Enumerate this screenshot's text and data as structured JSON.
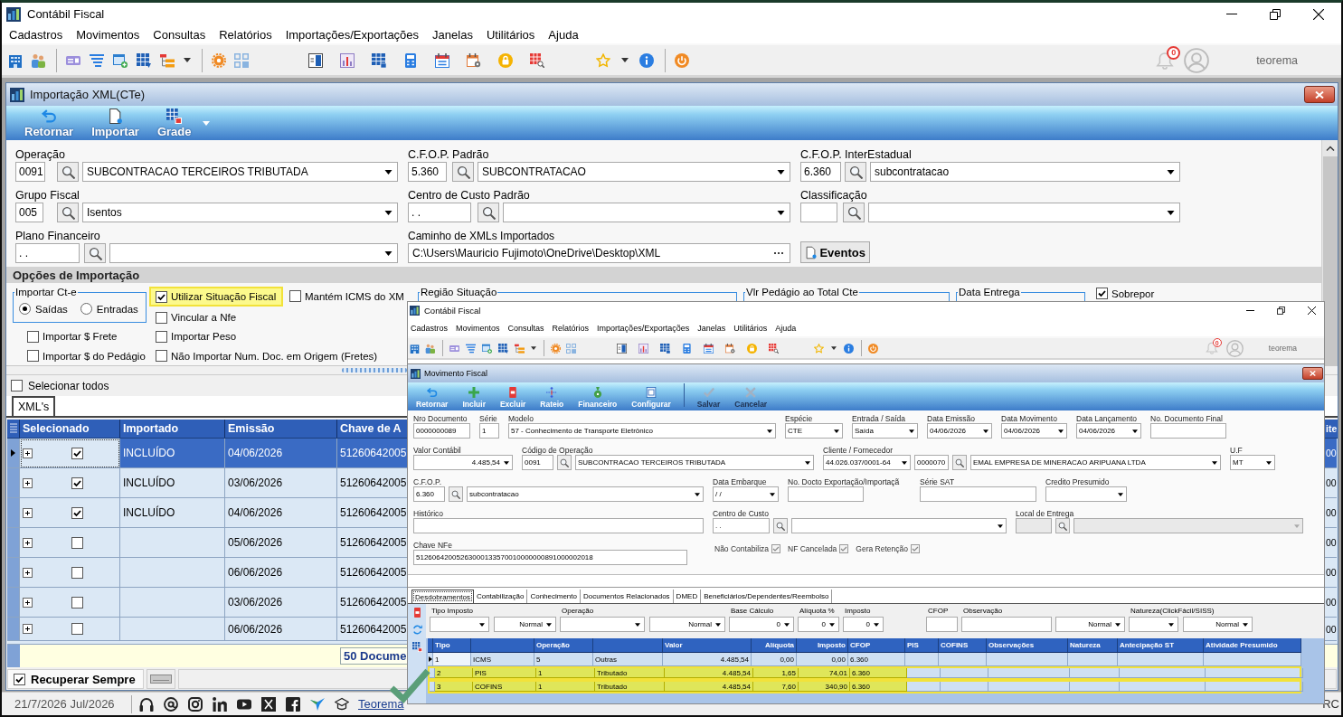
{
  "app": {
    "title": "Contábil Fiscal",
    "menu": [
      "Cadastros",
      "Movimentos",
      "Consultas",
      "Relatórios",
      "Importações/Exportações",
      "Janelas",
      "Utilitários",
      "Ajuda"
    ],
    "notification_count": "0",
    "user": "teorema"
  },
  "window": {
    "title": "Importação XML(CTe)",
    "toolbar": [
      {
        "label": "Retornar",
        "dropdown": false
      },
      {
        "label": "Importar",
        "dropdown": false
      },
      {
        "label": "Grade",
        "dropdown": true
      }
    ]
  },
  "form": {
    "fields": [
      {
        "label": "Operação",
        "code": "0091",
        "description": "SUBCONTRACAO TERCEIROS TRIBUTADA"
      },
      {
        "label": "C.F.O.P. Padrão",
        "code": "5.360",
        "description": "SUBCONTRATACAO"
      },
      {
        "label": "C.F.O.P. InterEstadual",
        "code": "6.360",
        "description": "subcontratacao"
      },
      {
        "label": "Grupo Fiscal",
        "code": "005",
        "description": "Isentos"
      },
      {
        "label": "Centro de Custo Padrão",
        "code": ". ."
      },
      {
        "label": "Classificação"
      },
      {
        "label": "Plano Financeiro",
        "code": ". ."
      }
    ],
    "path": {
      "label": "Caminho de XMLs Importados",
      "value": "C:\\Users\\Mauricio Fujimoto\\OneDrive\\Desktop\\XML"
    },
    "events_button": "Eventos"
  },
  "options": {
    "title": "Opções de Importação",
    "cte_group": {
      "title": "Importar Ct-e",
      "radios": [
        {
          "label": "Saídas",
          "selected": true
        },
        {
          "label": "Entradas",
          "selected": false
        }
      ]
    },
    "checks": [
      {
        "label": "Utilizar Situação Fiscal",
        "checked": true,
        "highlighted": true
      },
      {
        "label": "Vincular a Nfe",
        "checked": false,
        "highlighted": false
      },
      {
        "label": "Mantém ICMS do XM",
        "checked": false,
        "highlighted": false
      },
      {
        "label": "Importar $ Frete",
        "checked": false,
        "highlighted": false
      },
      {
        "label": "Importar $ do Pedágio",
        "checked": false,
        "highlighted": false
      },
      {
        "label": "Importar Peso",
        "checked": false,
        "highlighted": false
      },
      {
        "label": "Não Importar Num. Doc. em Origem (Fretes)",
        "checked": false,
        "highlighted": false
      }
    ],
    "groups": [
      "Região Situação",
      "Vlr Pedágio ao Total Cte",
      "Data Entrega"
    ],
    "overwrite": {
      "label": "Sobrepor",
      "checked": true
    }
  },
  "select_all": {
    "label": "Selecionar todos",
    "checked": false
  },
  "tabs": [
    {
      "label": "XML's",
      "selected": true
    }
  ],
  "table": {
    "columns": [
      "Selecionado",
      "Importado",
      "Emissão",
      "Chave de A",
      "ite"
    ],
    "rows": [
      {
        "current": true,
        "selected": true,
        "checked": true,
        "imported": "INCLUÍDO",
        "issued": "04/06/2026",
        "key": "51260642005",
        "column_5": "00"
      },
      {
        "current": false,
        "selected": false,
        "checked": true,
        "imported": "INCLUÍDO",
        "issued": "03/06/2026",
        "key": "51260642005",
        "column_5": "00"
      },
      {
        "current": false,
        "selected": false,
        "checked": true,
        "imported": "INCLUÍDO",
        "issued": "04/06/2026",
        "key": "51260642005",
        "column_5": "00"
      },
      {
        "current": false,
        "selected": false,
        "checked": false,
        "issued": "05/06/2026",
        "key": "51260642005",
        "column_5": "00"
      },
      {
        "current": false,
        "selected": false,
        "checked": false,
        "issued": "06/06/2026",
        "key": "51260642005",
        "column_5": "00"
      },
      {
        "current": false,
        "selected": false,
        "checked": false,
        "issued": "03/06/2026",
        "key": "51260642005",
        "column_5": "00"
      },
      {
        "current": false,
        "selected": false,
        "checked": false,
        "issued": "06/06/2026",
        "key": "51260642005",
        "column_5": "00"
      }
    ],
    "footer": "50 Docume"
  },
  "recover": {
    "label": "Recuperar Sempre",
    "checked": true
  },
  "status_bar": {
    "date": "21/7/2026 Jul/2026",
    "link": "Teorema",
    "cut_text": "RC"
  },
  "embedded_screenshot": {
    "app": {
      "title": "Contábil Fiscal",
      "menu": [
        "Cadastros",
        "Movimentos",
        "Consultas",
        "Relatórios",
        "Importações/Exportações",
        "Janelas",
        "Utilitários",
        "Ajuda"
      ],
      "notification_count": "0",
      "user": "teorema"
    },
    "window": {
      "title": "Movimento Fiscal",
      "toolbar": [
        {
          "label": "Retornar",
          "disabled": false
        },
        {
          "label": "Incluir",
          "disabled": false
        },
        {
          "label": "Excluir",
          "disabled": false
        },
        {
          "label": "Rateio",
          "disabled": false
        },
        {
          "label": "Financeiro",
          "disabled": false
        },
        {
          "label": "Configurar",
          "disabled": false
        },
        {
          "label": "Salvar",
          "disabled": true
        },
        {
          "label": "Cancelar",
          "disabled": true
        }
      ]
    },
    "form_rows": [
      [
        {
          "label": "Nro Documento",
          "kind": "text",
          "value": "0000000089",
          "disabled": false
        },
        {
          "label": "Série",
          "kind": "text",
          "value": "1",
          "disabled": false
        },
        {
          "label": "Modelo",
          "kind": "select",
          "value": "57 - Conhecimento de Transporte Eletrônico",
          "disabled": false
        },
        {
          "label": "Espécie",
          "kind": "select",
          "value": "CTE",
          "disabled": false
        },
        {
          "label": "Entrada / Saída",
          "kind": "select",
          "value": "Saída",
          "disabled": false
        },
        {
          "label": "Data Emissão",
          "kind": "select",
          "value": "04/06/2026",
          "disabled": false
        },
        {
          "label": "Data Movimento",
          "kind": "select",
          "value": "04/06/2026",
          "disabled": false
        },
        {
          "label": "Data Lançamento",
          "kind": "select",
          "value": "04/06/2026",
          "disabled": false
        },
        {
          "label": "No. Documento Final",
          "kind": "text",
          "disabled": false
        }
      ],
      [
        {
          "label": "Valor Contábil",
          "kind": "select",
          "value": "4.485,54",
          "disabled": false
        },
        {
          "label": "Código de Operação",
          "kind": "lookup",
          "code": "0091",
          "value": "SUBCONTRACAO TERCEIROS TRIBUTADA",
          "disabled": false
        },
        {
          "label": "Cliente / Fornecedor",
          "kind": "party",
          "document": "44.026.037/0001-64",
          "code": "0000070",
          "value": "EMAL EMPRESA DE MINERACAO ARIPUANA LTDA",
          "disabled": false
        },
        {
          "label": "U.F",
          "kind": "select",
          "value": "MT",
          "disabled": false
        }
      ],
      [
        {
          "label": "C.F.O.P.",
          "kind": "lookup",
          "code": "6.360",
          "value": "subcontratacao",
          "disabled": false
        },
        {
          "label": "Data Embarque",
          "kind": "select",
          "value": "/ /",
          "disabled": false
        },
        {
          "label": "No. Docto Exportação/Importaçã",
          "kind": "text",
          "disabled": false
        },
        {
          "label": "Série SAT",
          "kind": "text",
          "disabled": false
        },
        {
          "label": "Credito Presumido",
          "kind": "select",
          "disabled": false
        }
      ],
      [
        {
          "label": "Histórico",
          "kind": "text",
          "disabled": false
        },
        {
          "label": "Centro de Custo",
          "kind": "lookup",
          "code": ". .",
          "disabled": false
        },
        {
          "label": "Local de Entrega",
          "kind": "lookup",
          "disabled": true
        }
      ],
      [
        {
          "label": "Chave NFe",
          "kind": "text",
          "value": "51260642005263000133570010000000891000002018",
          "disabled": false
        }
      ]
    ],
    "flags": [
      {
        "label": "Não Contabiliza",
        "checked": true
      },
      {
        "label": "NF Cancelada",
        "checked": true
      },
      {
        "label": "Gera Retenção",
        "checked": true
      }
    ],
    "tabs": [
      {
        "label": "Desdobramentos",
        "selected": true
      },
      {
        "label": "Contabilização",
        "selected": false
      },
      {
        "label": "Conhecimento",
        "selected": false
      },
      {
        "label": "Documentos Relacionados",
        "selected": false
      },
      {
        "label": "DMED",
        "selected": false
      },
      {
        "label": "Beneficiários/Dependentes/Reembolso",
        "selected": false
      }
    ],
    "filters": [
      {
        "label": "Tipo Imposto",
        "controls": [
          {
            "kind": "select"
          },
          {
            "kind": "select",
            "value": "Normal"
          }
        ]
      },
      {
        "label": "Operação",
        "controls": [
          {
            "kind": "select"
          },
          {
            "kind": "select",
            "value": "Normal"
          }
        ]
      },
      {
        "label": "Base Cálculo",
        "controls": [
          {
            "kind": "select",
            "value": "0"
          }
        ]
      },
      {
        "label": "Alíquota %",
        "controls": [
          {
            "kind": "select",
            "value": "0"
          }
        ]
      },
      {
        "label": "Imposto",
        "controls": [
          {
            "kind": "select",
            "value": "0"
          }
        ]
      },
      {
        "label": "CFOP",
        "controls": [
          {
            "kind": "text"
          }
        ]
      },
      {
        "label": "Observação",
        "controls": [
          {
            "kind": "text"
          }
        ]
      },
      {
        "controls": [
          {
            "kind": "select",
            "value": "Normal"
          }
        ]
      },
      {
        "label": "Natureza(ClickFácil/SISS)",
        "controls": [
          {
            "kind": "select"
          },
          {
            "kind": "select",
            "value": "Normal"
          }
        ]
      }
    ],
    "grid": {
      "columns": [
        "Tipo",
        "",
        "Operação",
        "",
        "Valor",
        "Alíquota",
        "Imposto",
        "CFOP",
        "PIS",
        "COFINS",
        "Observações",
        "Natureza",
        "Antecipação ST",
        "Atividade Presumido"
      ],
      "rows": [
        {
          "current": true,
          "highlighted": false,
          "cells": [
            "1",
            "ICMS",
            "5",
            "Outras",
            "4.485,54",
            "0,00",
            "0,00",
            "6.360"
          ]
        },
        {
          "current": false,
          "highlighted": true,
          "cells": [
            "2",
            "PIS",
            "1",
            "Tributado",
            "4.485,54",
            "1,65",
            "74,01",
            "6.360"
          ]
        },
        {
          "current": false,
          "highlighted": true,
          "cells": [
            "3",
            "COFINS",
            "1",
            "Tributado",
            "4.485,54",
            "7,60",
            "340,90",
            "6.360"
          ]
        }
      ]
    }
  }
}
